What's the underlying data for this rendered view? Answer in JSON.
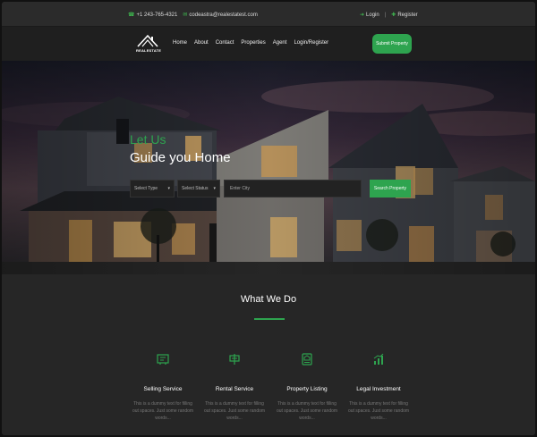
{
  "topbar": {
    "phone": "+1 243-765-4321",
    "email": "codeastra@realestatest.com",
    "login": "Login",
    "register": "Register"
  },
  "nav": {
    "logo_text": "REALESTATE",
    "links": [
      "Home",
      "About",
      "Contact",
      "Properties",
      "Agent",
      "Login/Register"
    ],
    "submit_label": "Submit Property"
  },
  "hero": {
    "title_line1": "Let Us",
    "title_line2": "Guide you Home",
    "select_type": "Select Type",
    "select_status": "Select Status",
    "city_placeholder": "Enter City",
    "search_label": "Search Property"
  },
  "whatwedo": {
    "title": "What We Do",
    "services": [
      {
        "name": "Selling Service",
        "icon": "sale-sign-icon",
        "desc1": "This is a dummy text for filling",
        "desc2": "out spaces. Just some random",
        "desc3": "words..."
      },
      {
        "name": "Rental Service",
        "icon": "rent-sign-icon",
        "desc1": "This is a dummy text for filling",
        "desc2": "out spaces. Just some random",
        "desc3": "words..."
      },
      {
        "name": "Property Listing",
        "icon": "listing-icon",
        "desc1": "This is a dummy text for filling",
        "desc2": "out spaces. Just some random",
        "desc3": "words..."
      },
      {
        "name": "Legal Investment",
        "icon": "investment-chart-icon",
        "desc1": "This is a dummy text for filling",
        "desc2": "out spaces. Just some random",
        "desc3": "words..."
      }
    ]
  },
  "colors": {
    "accent": "#2ea44f",
    "background": "#262626",
    "topbar": "#2b2b2b",
    "nav": "#1f1f1f"
  }
}
